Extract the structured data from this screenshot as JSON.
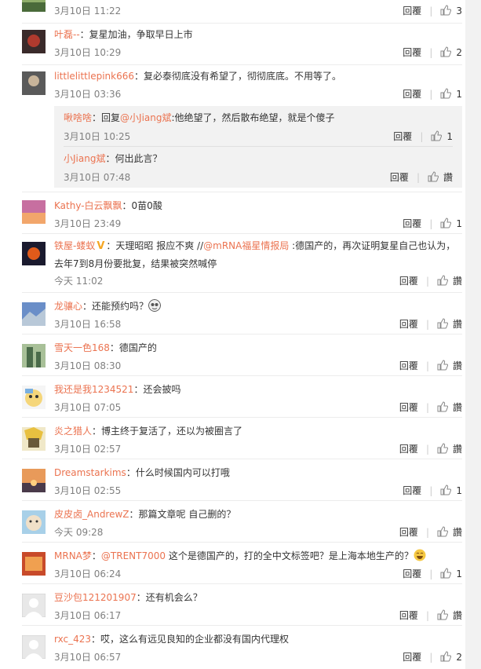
{
  "reply_label": "回覆",
  "pipe": "|",
  "like_zan": "讚",
  "comments": [
    {
      "user": "",
      "text": "",
      "time": "3月10日 11:22",
      "likes": "3",
      "colors": [
        "#8fae6a",
        "#4a6b3a"
      ]
    },
    {
      "user": "叶磊--",
      "text": "：复星加油，争取早日上市",
      "time": "3月10日 10:29",
      "likes": "2",
      "colors": [
        "#3a2a2a",
        "#b03a2e"
      ]
    },
    {
      "user": "littlelittlepink666",
      "text": "：复必泰彻底没有希望了，彻彻底底。不用等了。",
      "time": "3月10日 03:36",
      "likes": "1",
      "colors": [
        "#5a5a5a",
        "#c8b49a"
      ]
    },
    {
      "user": "Kathy-白云飘飘",
      "text": "：0苗0酸",
      "time": "3月10日 23:49",
      "likes": "1",
      "colors": [
        "#c76fa0",
        "#f2a66b"
      ]
    },
    {
      "user": "铁屋-蝼蚁",
      "verified": "V",
      "text_pre": "：天理昭昭 报应不爽 //",
      "mention": "@mRNA福星情报局",
      "text_post": " :德国产的，再次证明复星自己也认为，去年7到8月份要批复，结果被突然喊停",
      "time": "今天 11:02",
      "likes": "讚",
      "colors": [
        "#1a1a2e",
        "#e05a1a"
      ]
    },
    {
      "user": "龙骧心",
      "text": "：还能预约吗？",
      "emoji": "face-icon",
      "time": "3月10日 16:58",
      "likes": "讚",
      "colors": [
        "#6a8ec8",
        "#b8c8d8"
      ]
    },
    {
      "user": "雪天一色168",
      "text": "：德国产的",
      "time": "3月10日 08:30",
      "likes": "讚",
      "colors": [
        "#4a6b4a",
        "#a8c098"
      ]
    },
    {
      "user": "我还是我1234521",
      "text": "：还会披吗",
      "time": "3月10日 07:05",
      "likes": "讚",
      "colors": [
        "#f5d67a",
        "#7ab0e0"
      ]
    },
    {
      "user": "炎之猎人",
      "text": "：博主终于复活了，还以为被圈言了",
      "time": "3月10日 02:57",
      "likes": "讚",
      "colors": [
        "#e8c040",
        "#6a5a3a"
      ]
    },
    {
      "user": "Dreamstarkims",
      "text": "：什么时候国内可以打哦",
      "time": "3月10日 02:55",
      "likes": "1",
      "colors": [
        "#e89a5a",
        "#4a3a4a"
      ]
    },
    {
      "user": "皮皮卤_AndrewZ",
      "text": "：那篇文章呢 自己删的？",
      "time": "今天 09:28",
      "likes": "讚",
      "colors": [
        "#a8d0e8",
        "#f0e0c8"
      ]
    },
    {
      "user": "MRNA梦",
      "text_pre": "：",
      "mention": "@TRENT7000",
      "text_post": " 这个是德国产的，打的全中文标签吧？是上海本地生产的？",
      "emoji": "laugh-icon",
      "time": "3月10日 06:24",
      "likes": "1",
      "colors": [
        "#c84a2a",
        "#f0a050"
      ]
    },
    {
      "user": "豆沙包121201907",
      "text": "：还有机会么？",
      "time": "3月10日 06:17",
      "likes": "讚",
      "colors": [
        "#e8e8e8",
        "#d0d0d0"
      ]
    },
    {
      "user": "rxc_423",
      "text": "：哎，这么有远见良知的企业都没有国内代理权",
      "time": "3月10日 06:57",
      "likes": "2",
      "colors": [
        "#e8e8e8",
        "#d0d0d0"
      ]
    }
  ],
  "quote_replies": [
    {
      "user": "啾啥啥",
      "text_pre": "：回复",
      "mention": "@小Jiang斌",
      "text_post": ":他绝望了，然后散布绝望，就是个傻子",
      "time": "3月10日 10:25",
      "likes": "1"
    },
    {
      "user": "小Jiang斌",
      "text": "：何出此言？",
      "time": "3月10日 07:48",
      "likes": "讚"
    }
  ]
}
